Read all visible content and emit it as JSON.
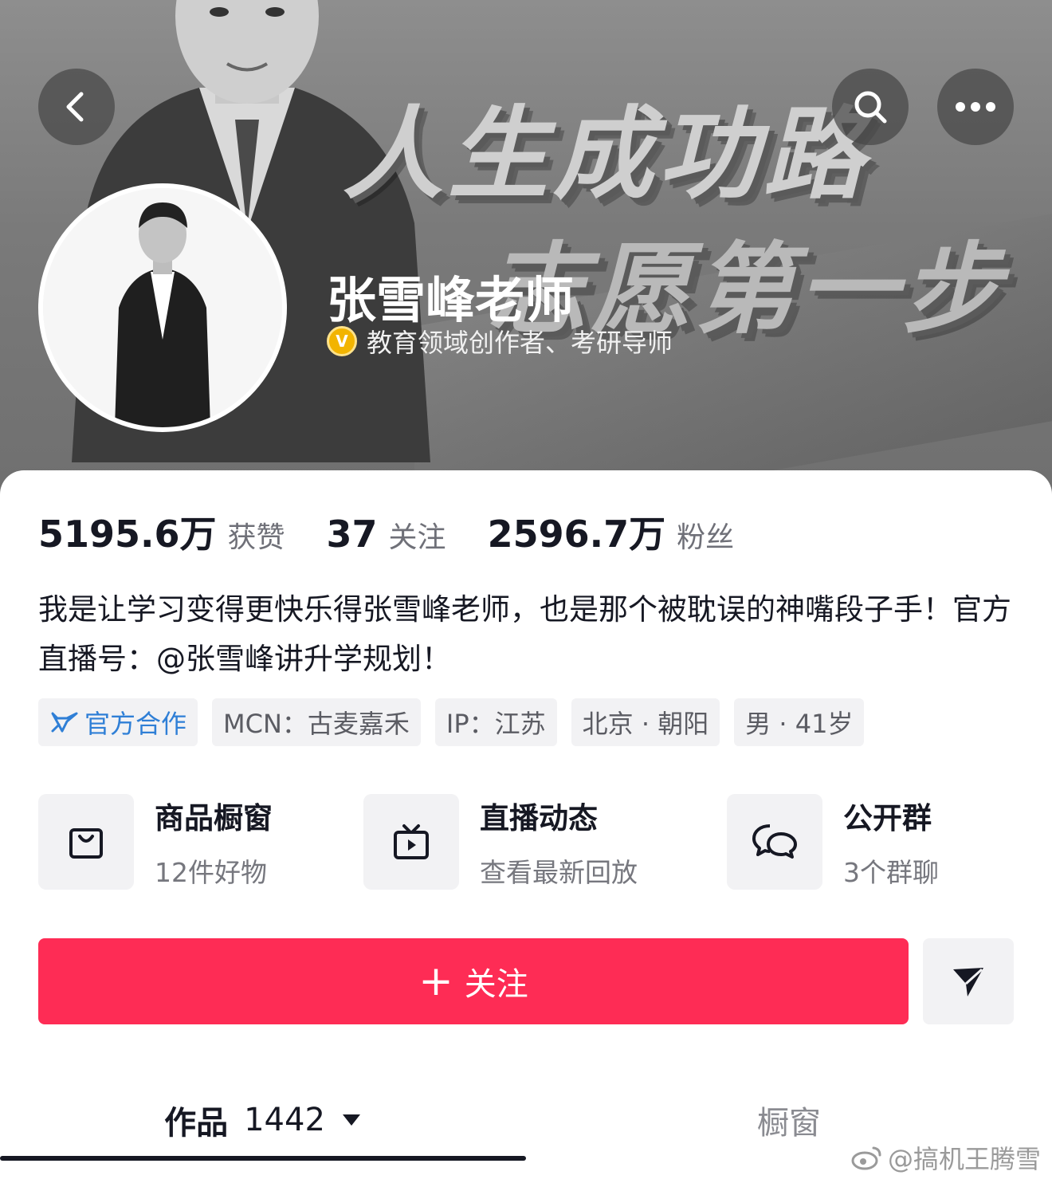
{
  "header": {
    "slogan_line1": "人生成功路",
    "slogan_line2": "志愿第一步",
    "back_icon": "chevron-left-icon",
    "search_icon": "search-icon",
    "more_icon": "more-dots-icon"
  },
  "profile": {
    "name": "张雪峰老师",
    "verify_badge": "V",
    "verify_text": "教育领域创作者、考研导师"
  },
  "stats": [
    {
      "value": "5195.6万",
      "label": "获赞"
    },
    {
      "value": "37",
      "label": "关注"
    },
    {
      "value": "2596.7万",
      "label": "粉丝"
    }
  ],
  "bio": "我是让学习变得更快乐得张雪峰老师，也是那个被耽误的神嘴段子手！官方直播号：@张雪峰讲升学规划！",
  "tags": {
    "official": "官方合作",
    "mcn": "MCN：古麦嘉禾",
    "ip": "IP：江苏",
    "location": "北京 · 朝阳",
    "gender_age": "男 · 41岁"
  },
  "features": [
    {
      "title": "商品橱窗",
      "subtitle": "12件好物",
      "icon": "shopping-bag-icon"
    },
    {
      "title": "直播动态",
      "subtitle": "查看最新回放",
      "icon": "tv-play-icon"
    },
    {
      "title": "公开群",
      "subtitle": "3个群聊",
      "icon": "chat-bubbles-icon"
    }
  ],
  "actions": {
    "follow_plus": "+",
    "follow_label": "关注",
    "share_icon": "send-icon"
  },
  "tabs": {
    "works_label": "作品",
    "works_count": "1442",
    "window_label": "橱窗"
  },
  "watermark": "@搞机王腾雪",
  "colors": {
    "accent": "#fe2c55",
    "official_blue": "#2f7fd6",
    "verify_gold": "#f2b400"
  }
}
